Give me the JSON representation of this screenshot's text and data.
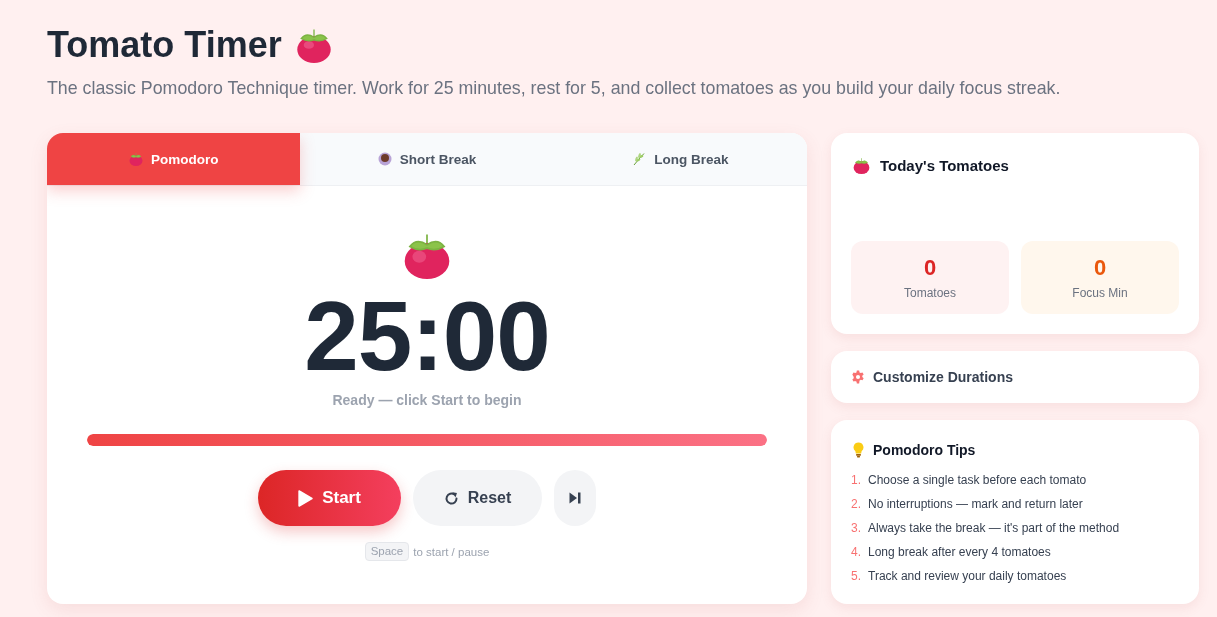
{
  "header": {
    "title": "Tomato Timer",
    "subtitle": "The classic Pomodoro Technique timer. Work for 25 minutes, rest for 5, and collect tomatoes as you build your daily focus streak."
  },
  "timer": {
    "tabs": [
      {
        "label": "Pomodoro",
        "kind": "tomato",
        "selected": true
      },
      {
        "label": "Short Break",
        "kind": "cup",
        "selected": false
      },
      {
        "label": "Long Break",
        "kind": "leaf",
        "selected": false
      }
    ],
    "time": "25:00",
    "status": "Ready — click Start to begin",
    "progress": {
      "level": 1
    },
    "buttons": [
      {
        "kind": "start",
        "label": "Start"
      },
      {
        "kind": "reset",
        "label": "Reset"
      },
      {
        "kind": "skip"
      }
    ],
    "hint": {
      "key": "Space",
      "text": "to start / pause"
    }
  },
  "today": {
    "title": "Today's Tomatoes",
    "stats": [
      {
        "kind": "tomatoes",
        "value": "0",
        "label": "Tomatoes"
      },
      {
        "kind": "focus",
        "value": "0",
        "label": "Focus Min"
      }
    ]
  },
  "customize": {
    "title": "Customize Durations"
  },
  "tips": {
    "title": "Pomodoro Tips",
    "items": [
      {
        "number": "1.",
        "text": "Choose a single task before each tomato"
      },
      {
        "number": "2.",
        "text": "No interruptions — mark and return later"
      },
      {
        "number": "3.",
        "text": "Always take the break — it's part of the method"
      },
      {
        "number": "4.",
        "text": "Long break after every 4 tomatoes"
      },
      {
        "number": "5.",
        "text": "Track and review your daily tomatoes"
      }
    ]
  }
}
